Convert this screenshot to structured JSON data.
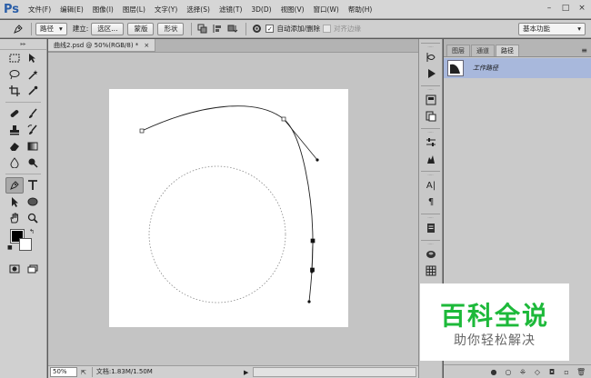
{
  "app": {
    "logo": "Ps"
  },
  "menu": {
    "items": [
      "文件(F)",
      "编辑(E)",
      "图像(I)",
      "图层(L)",
      "文字(Y)",
      "选择(S)",
      "滤镜(T)",
      "3D(D)",
      "视图(V)",
      "窗口(W)",
      "帮助(H)"
    ],
    "window_buttons": [
      "–",
      "□",
      "×"
    ]
  },
  "options_bar": {
    "tool_icon": "pen-icon",
    "mode_select": "路径",
    "build_label": "建立:",
    "selection_button": "选区...",
    "mask_button": "蒙版",
    "shape_button": "形状",
    "auto_add_delete_label": "自动添加/删除",
    "auto_add_delete_checked": true,
    "align_edges_label": "对齐边缘",
    "align_edges_checked": false,
    "workspace": "基本功能"
  },
  "document": {
    "tab_title": "曲线2.psd @ 50%(RGB/8) *",
    "tab_close": "×"
  },
  "status": {
    "zoom": "50%",
    "doc_info": "文档:1.83M/1.50M",
    "arrow": "▶"
  },
  "panel": {
    "tabs": [
      "图层",
      "通道",
      "路径"
    ],
    "active_tab": "路径",
    "path_name": "工作路径",
    "menu_icon": "≡"
  },
  "watermark": {
    "title": "百科全说",
    "subtitle": "助你轻松解决"
  },
  "colors": {
    "foreground": "#000000",
    "background": "#ffffff",
    "path_selected_bg": "#a8b8dc",
    "watermark_green": "#1db93a"
  }
}
